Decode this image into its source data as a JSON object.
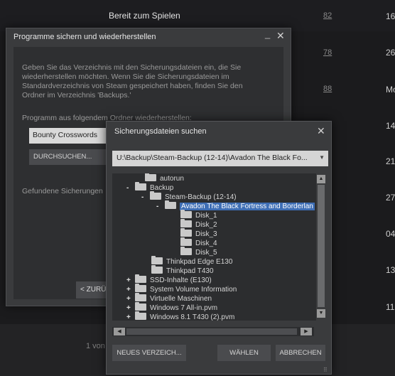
{
  "background": {
    "status": "Bereit zum Spielen",
    "numbers": [
      "82",
      "78",
      "88"
    ],
    "right_values": [
      "16",
      "26",
      "Mo",
      "14",
      "21",
      "27",
      "04",
      "13",
      "11"
    ],
    "footer_text": "1 von"
  },
  "restore_dialog": {
    "title": "Programme sichern und wiederherstellen",
    "description": "Geben Sie das Verzeichnis mit den Sicherungsdateien ein, die Sie wiederherstellen möchten. Wenn Sie die Sicherungsdateien im Standardverzeichnis von Steam gespeichert haben, finden Sie den Ordner im Verzeichnis 'Backups.'",
    "restore_label": "Programm aus folgendem Ordner wiederherstellen:",
    "folder_value": "Bounty Crosswords",
    "browse_label": "DURCHSUCHEN...",
    "found_label": "Gefundene Sicherungen",
    "back_label": "< ZURÜCK"
  },
  "browse_dialog": {
    "title": "Sicherungsdateien suchen",
    "path": "U:\\Backup\\Steam-Backup (12-14)\\Avadon The Black Fo...",
    "tree": [
      {
        "toggle": "",
        "label": "autorun"
      },
      {
        "toggle": "-",
        "label": "Backup"
      },
      {
        "toggle": "-",
        "label": "Steam-Backup (12-14)"
      },
      {
        "toggle": "-",
        "label": "Avadon The Black Fortress and Borderlan"
      },
      {
        "toggle": "",
        "label": "Disk_1"
      },
      {
        "toggle": "",
        "label": "Disk_2"
      },
      {
        "toggle": "",
        "label": "Disk_3"
      },
      {
        "toggle": "",
        "label": "Disk_4"
      },
      {
        "toggle": "",
        "label": "Disk_5"
      },
      {
        "toggle": "",
        "label": "Thinkpad Edge E130"
      },
      {
        "toggle": "",
        "label": "Thinkpad T430"
      },
      {
        "toggle": "+",
        "label": "SSD-Inhalte (E130)"
      },
      {
        "toggle": "+",
        "label": "System Volume Information"
      },
      {
        "toggle": "+",
        "label": "Virtuelle Maschinen"
      },
      {
        "toggle": "+",
        "label": "Windows 7 All-in.pvm"
      },
      {
        "toggle": "+",
        "label": "Windows 8.1 T430 (2).pvm"
      }
    ],
    "new_dir_label": "NEUES VERZEICH...",
    "choose_label": "WÄHLEN",
    "cancel_label": "ABBRECHEN"
  }
}
